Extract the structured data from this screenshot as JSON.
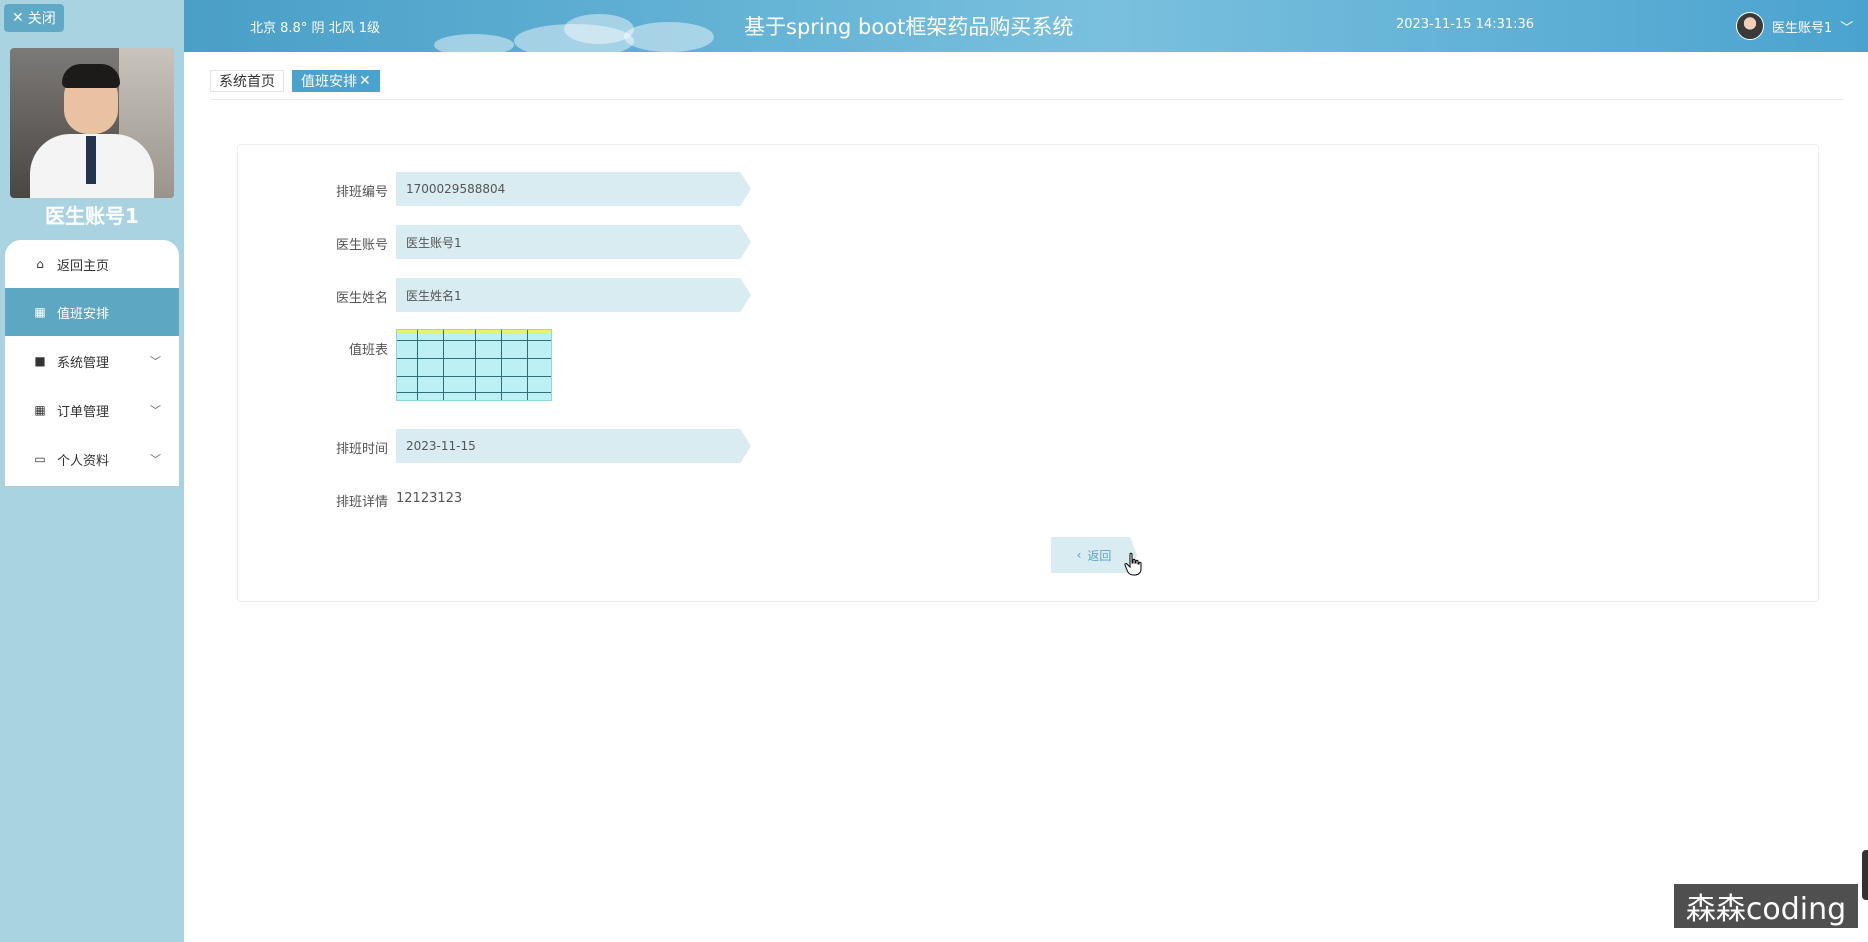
{
  "sidebar": {
    "close_label": "关闭",
    "user_name": "医生账号1",
    "menu": [
      {
        "label": "返回主页",
        "icon": "home-icon",
        "active": false,
        "has_children": false
      },
      {
        "label": "值班安排",
        "icon": "grid-icon",
        "active": true,
        "has_children": false
      },
      {
        "label": "系统管理",
        "icon": "book-icon",
        "active": false,
        "has_children": true
      },
      {
        "label": "订单管理",
        "icon": "grid-icon",
        "active": false,
        "has_children": true
      },
      {
        "label": "个人资料",
        "icon": "card-icon",
        "active": false,
        "has_children": true
      }
    ]
  },
  "topbar": {
    "weather": "北京  8.8°  阴  北风  1级",
    "title": "基于spring boot框架药品购买系统",
    "datetime": "2023-11-15 14:31:36",
    "user": "医生账号1"
  },
  "tabs": [
    {
      "label": "系统首页",
      "active": false
    },
    {
      "label": "值班安排",
      "active": true
    }
  ],
  "form": {
    "schedule_no_label": "排班编号",
    "schedule_no": "1700029588804",
    "doctor_account_label": "医生账号",
    "doctor_account": "医生账号1",
    "doctor_name_label": "医生姓名",
    "doctor_name": "医生姓名1",
    "duty_table_label": "值班表",
    "schedule_time_label": "排班时间",
    "schedule_time": "2023-11-15",
    "schedule_detail_label": "排班详情",
    "schedule_detail": "12123123",
    "back_button": "返回"
  },
  "watermark": "森森coding",
  "colors": {
    "sidebar_bg": "#a9d3e1",
    "accent": "#4aa3cf",
    "input_bg": "#d8ecf1"
  }
}
